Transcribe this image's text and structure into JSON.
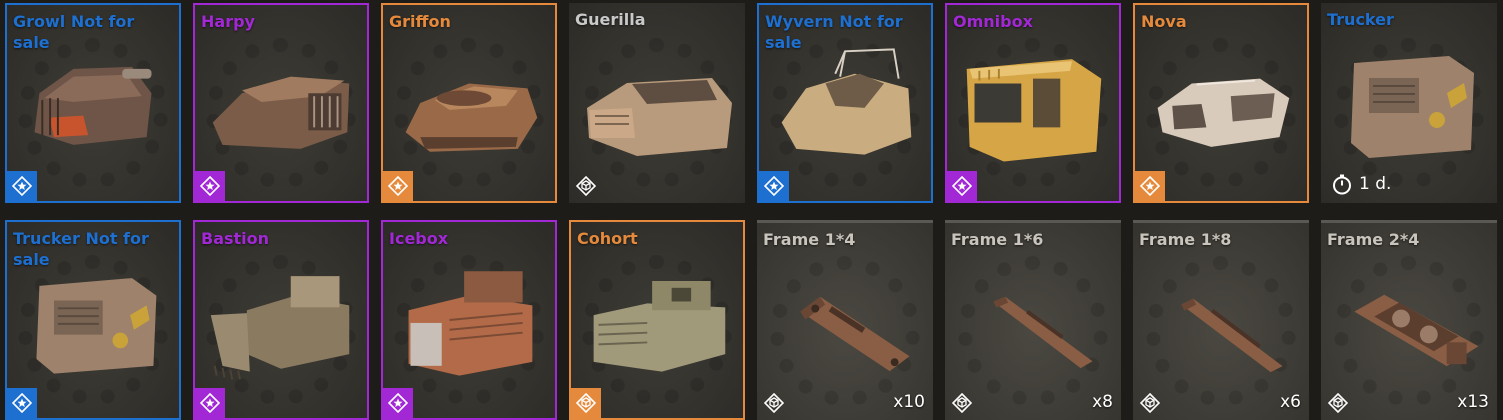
{
  "colors": {
    "blue": "#1d6fd0",
    "purple": "#a228d6",
    "orange": "#e58a3c",
    "grey_text": "#c9c9c9",
    "frame_text": "#c9c5bd"
  },
  "row1": [
    {
      "name": "Growl Not for sale",
      "rarity": "blue",
      "icon": "star-badge-icon"
    },
    {
      "name": "Harpy",
      "rarity": "purple",
      "icon": "star-badge-icon"
    },
    {
      "name": "Griffon",
      "rarity": "orange",
      "icon": "star-badge-icon"
    },
    {
      "name": "Guerilla",
      "rarity": "none",
      "icon": "cube-badge-icon"
    },
    {
      "name": "Wyvern Not for sale",
      "rarity": "blue",
      "icon": "star-badge-icon"
    },
    {
      "name": "Omnibox",
      "rarity": "purple",
      "icon": "star-badge-icon"
    },
    {
      "name": "Nova",
      "rarity": "orange",
      "icon": "star-badge-icon"
    },
    {
      "name": "Trucker",
      "rarity": "none",
      "icon": "stopwatch-icon",
      "timer": "1 d."
    }
  ],
  "row2": [
    {
      "name": "Trucker Not for sale",
      "rarity": "blue",
      "icon": "star-badge-icon"
    },
    {
      "name": "Bastion",
      "rarity": "purple",
      "icon": "star-badge-icon"
    },
    {
      "name": "Icebox",
      "rarity": "purple",
      "icon": "star-badge-icon"
    },
    {
      "name": "Cohort",
      "rarity": "orange",
      "icon": "cube-badge-icon"
    },
    {
      "name": "Frame 1*4",
      "rarity": "frame",
      "icon": "cube-badge-icon",
      "count": "x10"
    },
    {
      "name": "Frame 1*6",
      "rarity": "frame",
      "icon": "cube-badge-icon",
      "count": "x8"
    },
    {
      "name": "Frame 1*8",
      "rarity": "frame",
      "icon": "cube-badge-icon",
      "count": "x6"
    },
    {
      "name": "Frame 2*4",
      "rarity": "frame",
      "icon": "cube-badge-icon",
      "count": "x13"
    }
  ]
}
